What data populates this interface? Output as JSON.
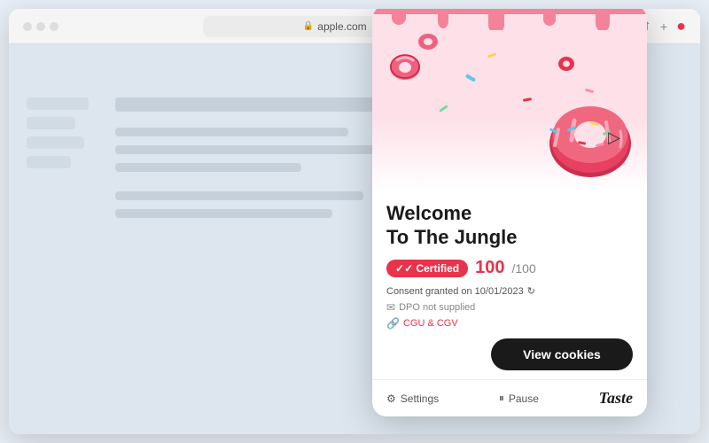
{
  "browser": {
    "url": "apple.com",
    "lock_icon": "🔒",
    "reload_icon": "⟳",
    "share_icon": "⬆",
    "new_tab_icon": "+",
    "profile_icon": "●"
  },
  "popup": {
    "title_line1": "Welcome",
    "title_line2": "To The Jungle",
    "certified_label": "✓ Certified",
    "score": "100",
    "score_total": "/100",
    "consent_label": "Consent granted on 10/01/2023",
    "refresh_icon": "↻",
    "dpo_label": "DPO not supplied",
    "cgu_label": "CGU & CGV",
    "view_cookies_label": "View cookies"
  },
  "footer": {
    "settings_label": "Settings",
    "pause_label": "Pause",
    "logo": "Taste"
  }
}
